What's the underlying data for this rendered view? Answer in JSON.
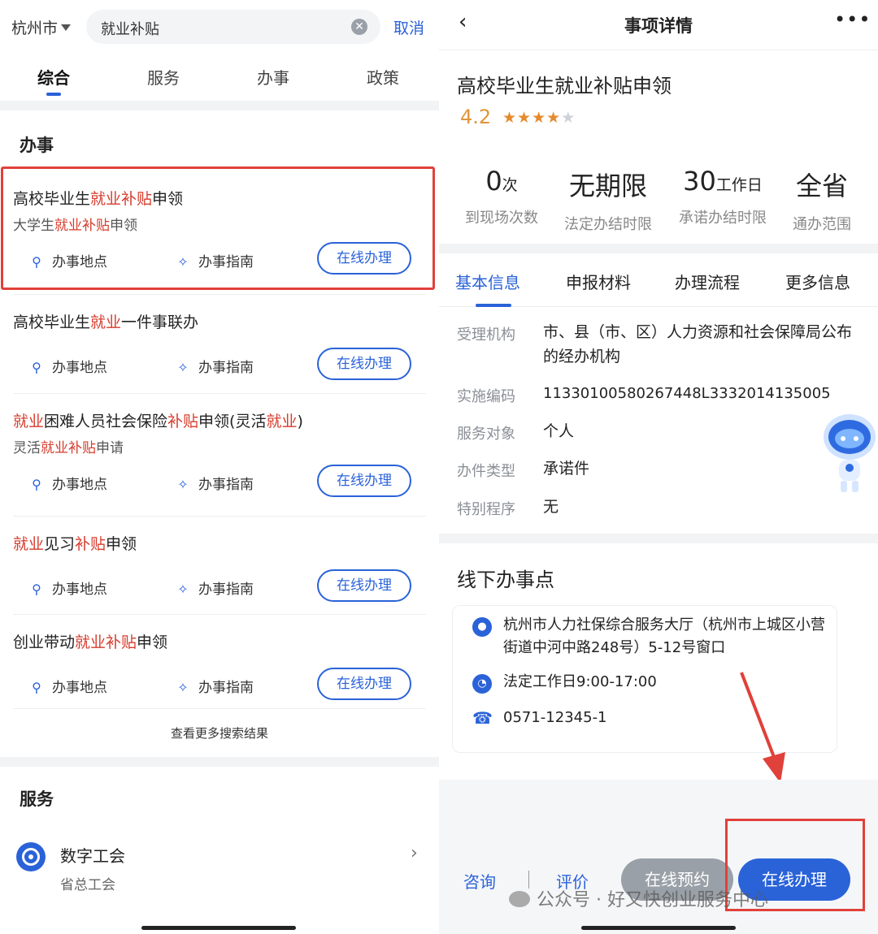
{
  "left": {
    "city": "杭州市",
    "search_query": "就业补贴",
    "cancel": "取消",
    "tabs": [
      "综合",
      "服务",
      "办事",
      "政策"
    ],
    "section_banshi": "办事",
    "results": [
      {
        "title": [
          [
            "高校毕业生",
            0
          ],
          [
            "就业补贴",
            1
          ],
          [
            "申领",
            0
          ]
        ],
        "sub": [
          [
            "大学生",
            0
          ],
          [
            "就业补贴",
            1
          ],
          [
            "申领",
            0
          ]
        ]
      },
      {
        "title": [
          [
            "高校毕业生",
            0
          ],
          [
            "就业",
            1
          ],
          [
            "一件事联办",
            0
          ]
        ],
        "sub": null
      },
      {
        "title": [
          [
            "就业",
            1
          ],
          [
            "困难人员社会保险",
            0
          ],
          [
            "补贴",
            1
          ],
          [
            "申领(灵活",
            0
          ],
          [
            "就业",
            1
          ],
          [
            ")",
            0
          ]
        ],
        "sub": [
          [
            "灵活",
            0
          ],
          [
            "就业补贴",
            1
          ],
          [
            "申请",
            0
          ]
        ]
      },
      {
        "title": [
          [
            "就业",
            1
          ],
          [
            "见习",
            0
          ],
          [
            "补贴",
            1
          ],
          [
            "申领",
            0
          ]
        ],
        "sub": null
      },
      {
        "title": [
          [
            "创业带动",
            0
          ],
          [
            "就业补贴",
            1
          ],
          [
            "申领",
            0
          ]
        ],
        "sub": null
      }
    ],
    "action_location": "办事地点",
    "action_guide": "办事指南",
    "action_online": "在线办理",
    "more_results": "查看更多搜索结果",
    "section_fuwu": "服务",
    "service": {
      "name": "数字工会",
      "org": "省总工会"
    }
  },
  "right": {
    "nav_title": "事项详情",
    "title": "高校毕业生就业补贴申领",
    "rating": "4.2",
    "stars": 4.2,
    "stats": [
      {
        "value": "0",
        "unit": "次",
        "label": "到现场次数"
      },
      {
        "value": "无期限",
        "unit": "",
        "label": "法定办结时限"
      },
      {
        "value": "30",
        "unit": "工作日",
        "label": "承诺办结时限"
      },
      {
        "value": "全省",
        "unit": "",
        "label": "通办范围"
      }
    ],
    "tabs": [
      "基本信息",
      "申报材料",
      "办理流程",
      "更多信息"
    ],
    "info": [
      {
        "label": "受理机构",
        "value": "市、县（市、区）人力资源和社会保障局公布的经办机构"
      },
      {
        "label": "实施编码",
        "value": "11330100580267448L3332014135005"
      },
      {
        "label": "服务对象",
        "value": "个人"
      },
      {
        "label": "办件类型",
        "value": "承诺件"
      },
      {
        "label": "特别程序",
        "value": "无"
      }
    ],
    "offline_title": "线下办事点",
    "office": {
      "address": "杭州市人力社保综合服务大厅（杭州市上城区小营街道中河中路248号）5-12号窗口",
      "hours": "法定工作日9:00-17:00",
      "phone": "0571-12345-1"
    },
    "consult": "咨询",
    "review": "评价",
    "book": "在线预约",
    "go": "在线办理",
    "watermark": "公众号 · 好又快创业服务中心"
  },
  "colors": {
    "accent": "#2a62d8",
    "highlight": "#d63b2c",
    "annotation": "#e0413a",
    "star": "#e58a2d"
  }
}
